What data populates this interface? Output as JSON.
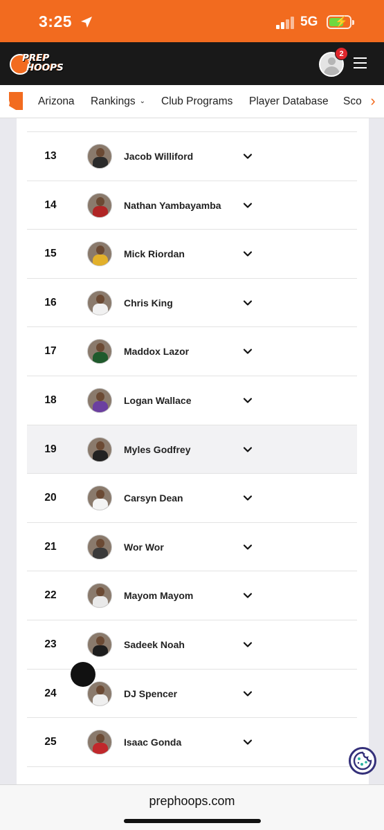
{
  "status_bar": {
    "time": "3:25",
    "network": "5G",
    "battery_level": 0.7,
    "icons": [
      "location-arrow-icon",
      "signal-icon",
      "battery-charging-icon"
    ]
  },
  "header": {
    "logo_line1": "PREP",
    "logo_line2": "HOOPS",
    "notification_count": "2",
    "icons": [
      "user-avatar-icon",
      "hamburger-menu-icon"
    ],
    "brand_color": "#f26b1f"
  },
  "subnav": {
    "items": [
      {
        "label": "Arizona"
      },
      {
        "label": "Rankings",
        "has_dropdown": true
      },
      {
        "label": "Club Programs"
      },
      {
        "label": "Player Database"
      },
      {
        "label": "Sco"
      }
    ],
    "icons": [
      "arizona-state-icon",
      "chevron-down-icon",
      "chevron-right-icon"
    ]
  },
  "rankings": {
    "rows": [
      {
        "rank": "13",
        "name": "Jacob Williford",
        "jersey": "#2b2b2b"
      },
      {
        "rank": "14",
        "name": "Nathan Yambayamba",
        "jersey": "#b02525"
      },
      {
        "rank": "15",
        "name": "Mick Riordan",
        "jersey": "#e2b02a"
      },
      {
        "rank": "16",
        "name": "Chris King",
        "jersey": "#f1f1f1"
      },
      {
        "rank": "17",
        "name": "Maddox Lazor",
        "jersey": "#1f5a2c"
      },
      {
        "rank": "18",
        "name": "Logan Wallace",
        "jersey": "#6b3fa0"
      },
      {
        "rank": "19",
        "name": "Myles Godfrey",
        "jersey": "#222222",
        "highlighted": true
      },
      {
        "rank": "20",
        "name": "Carsyn Dean",
        "jersey": "#f4f4f4"
      },
      {
        "rank": "21",
        "name": "Wor Wor",
        "jersey": "#3a3a3a"
      },
      {
        "rank": "22",
        "name": "Mayom Mayom",
        "jersey": "#e9e9e9"
      },
      {
        "rank": "23",
        "name": "Sadeek Noah",
        "jersey": "#1d1d1d"
      },
      {
        "rank": "24",
        "name": "DJ Spencer",
        "jersey": "#efefef"
      },
      {
        "rank": "25",
        "name": "Isaac Gonda",
        "jersey": "#c0282b"
      }
    ]
  },
  "cookie_button": {
    "icon": "cookie-icon"
  },
  "browser": {
    "url": "prephoops.com"
  }
}
